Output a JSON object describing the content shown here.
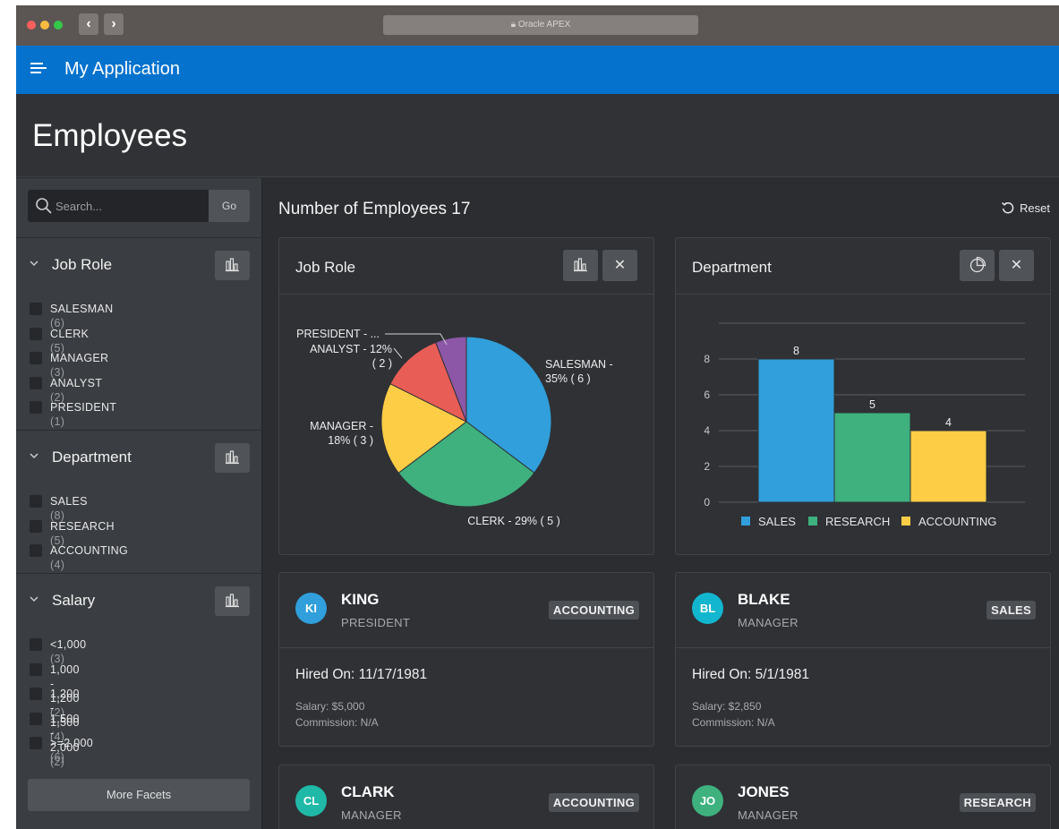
{
  "browser": {
    "url_text": "Oracle APEX"
  },
  "app": {
    "title": "My Application"
  },
  "page": {
    "title": "Employees"
  },
  "search": {
    "placeholder": "Search...",
    "go_label": "Go"
  },
  "facets": [
    {
      "title": "Job Role",
      "items": [
        {
          "label": "SALESMAN",
          "count": "(6)"
        },
        {
          "label": "CLERK",
          "count": "(5)"
        },
        {
          "label": "MANAGER",
          "count": "(3)"
        },
        {
          "label": "ANALYST",
          "count": "(2)"
        },
        {
          "label": "PRESIDENT",
          "count": "(1)"
        }
      ]
    },
    {
      "title": "Department",
      "items": [
        {
          "label": "SALES",
          "count": "(8)"
        },
        {
          "label": "RESEARCH",
          "count": "(5)"
        },
        {
          "label": "ACCOUNTING",
          "count": "(4)"
        }
      ]
    },
    {
      "title": "Salary",
      "items": [
        {
          "label": "<1,000",
          "count": "(3)"
        },
        {
          "label": "1,000 - 1,200",
          "count": "(2)"
        },
        {
          "label": "1,200 - 1,500",
          "count": "(4)"
        },
        {
          "label": "1,500 - 2,000",
          "count": "(2)"
        },
        {
          "label": ">=2,000",
          "count": "(6)"
        }
      ]
    }
  ],
  "more_facets_label": "More Facets",
  "main": {
    "count_title": "Number of Employees 17",
    "reset_label": "Reset"
  },
  "job_chart": {
    "card_title": "Job Role",
    "close_glyph": "✕",
    "label_lines": [
      [
        "PRESIDENT - ..."
      ],
      [
        "ANALYST - 12%",
        "( 2 )"
      ],
      [
        "MANAGER -",
        "18% ( 3 )"
      ],
      [
        "SALESMAN -",
        "35% ( 6 )"
      ],
      [
        "CLERK - 29% ( 5 )"
      ]
    ]
  },
  "dept_chart": {
    "card_title": "Department",
    "close_glyph": "✕"
  },
  "chart_data": [
    {
      "type": "pie",
      "categories": [
        "SALESMAN",
        "CLERK",
        "MANAGER",
        "ANALYST",
        "PRESIDENT"
      ],
      "values": [
        6,
        5,
        3,
        2,
        1
      ],
      "colors": [
        "#309fdb",
        "#3eb17e",
        "#fecd46",
        "#e85d56",
        "#8d57a7"
      ]
    },
    {
      "type": "bar",
      "categories": [
        "SALES",
        "RESEARCH",
        "ACCOUNTING"
      ],
      "values": [
        8,
        5,
        4
      ],
      "colors": [
        "#309fdb",
        "#3eb17e",
        "#fecd46"
      ],
      "ylim": [
        0,
        10
      ],
      "yticks": [
        0,
        2,
        4,
        6,
        8
      ],
      "legend": "bottom",
      "grid": true
    }
  ],
  "employees": [
    {
      "initials": "KI",
      "name": "KING",
      "role": "PRESIDENT",
      "dept": "ACCOUNTING",
      "hired": "Hired On: 11/17/1981",
      "salary": "Salary: $5,000",
      "commission": "Commission: N/A",
      "color": "#309fdb"
    },
    {
      "initials": "BL",
      "name": "BLAKE",
      "role": "MANAGER",
      "dept": "SALES",
      "hired": "Hired On: 5/1/1981",
      "salary": "Salary: $2,850",
      "commission": "Commission: N/A",
      "color": "#13b6cf"
    },
    {
      "initials": "CL",
      "name": "CLARK",
      "role": "MANAGER",
      "dept": "ACCOUNTING",
      "hired": "",
      "salary": "",
      "commission": "",
      "color": "#20b9a8"
    },
    {
      "initials": "JO",
      "name": "JONES",
      "role": "MANAGER",
      "dept": "RESEARCH",
      "hired": "",
      "salary": "",
      "commission": "",
      "color": "#3eb17e"
    }
  ],
  "colors": {
    "appbar": "#0572ce",
    "background": "#2b2d30",
    "sidebar": "#3a3d41"
  }
}
